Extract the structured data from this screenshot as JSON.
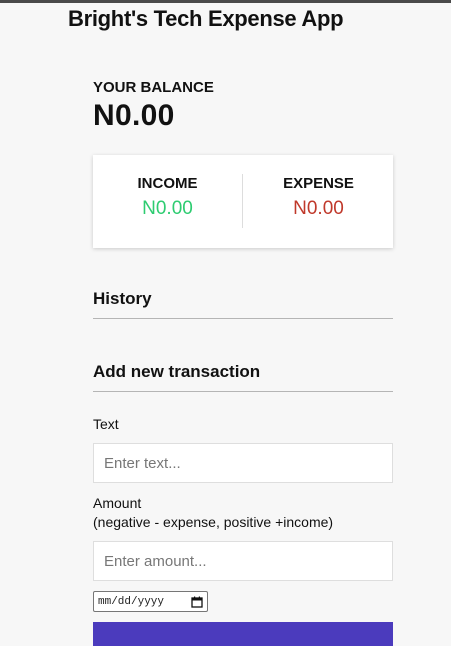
{
  "app": {
    "title": "Bright's Tech Expense App"
  },
  "balance": {
    "label": "YOUR BALANCE",
    "value": "N0.00"
  },
  "summary": {
    "income_label": "INCOME",
    "income_value": "N0.00",
    "expense_label": "EXPENSE",
    "expense_value": "N0.00"
  },
  "history": {
    "title": "History"
  },
  "form": {
    "title": "Add new transaction",
    "text_label": "Text",
    "text_placeholder": "Enter text...",
    "amount_label": "Amount",
    "amount_hint": "(negative - expense, positive +income)",
    "amount_placeholder": "Enter amount...",
    "date_placeholder": "mm/dd/yyyy"
  },
  "colors": {
    "income": "#2ecc71",
    "expense": "#c0392b",
    "accent": "#4b3bbd"
  }
}
